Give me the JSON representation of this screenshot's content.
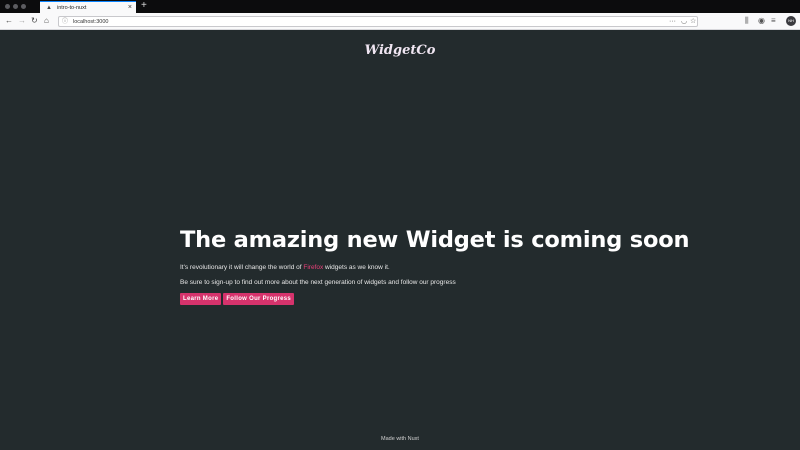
{
  "browser": {
    "tab_title": "intro-to-nuxt",
    "tab_favicon": "▲",
    "tab_close": "×",
    "new_tab": "+",
    "url": "localhost:3000",
    "profile_initials": "NH"
  },
  "site": {
    "logo": "WidgetCo"
  },
  "hero": {
    "title": "The amazing new Widget is coming soon",
    "line1_before": "It's revolutionary it will change the world of ",
    "line1_accent": "Firefox",
    "line1_after": " widgets as we know it.",
    "line2": "Be sure to sign-up to find out more about the next generation of widgets and follow our progress",
    "learn_more": "Learn More",
    "follow_progress": "Follow Our Progress"
  },
  "footer": {
    "text": "Made with Nuxt"
  },
  "colors": {
    "background": "#232b2d",
    "accent": "#d6336c",
    "link": "#ec407a"
  },
  "icons": {
    "back": "back-arrow-icon",
    "forward": "forward-arrow-icon",
    "reload": "reload-icon",
    "home": "home-icon",
    "info": "info-icon",
    "more": "more-dots-icon",
    "pocket": "pocket-icon",
    "bookmark": "star-icon",
    "library": "library-icon",
    "sync": "sync-icon",
    "menu": "hamburger-menu-icon"
  }
}
